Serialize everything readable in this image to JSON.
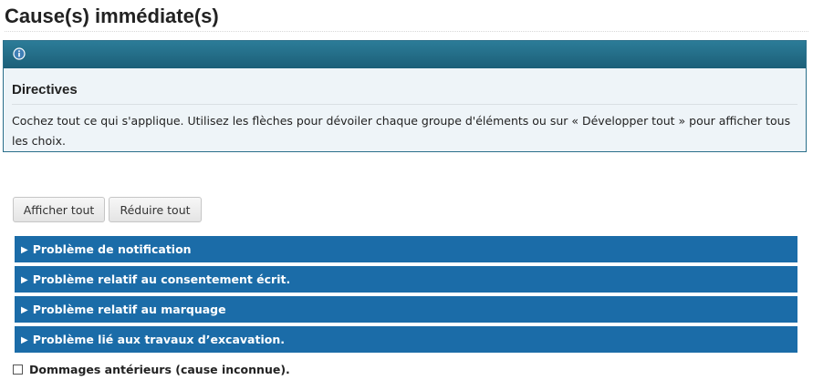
{
  "page": {
    "title": "Cause(s) immédiate(s)"
  },
  "info_panel": {
    "icon": "info-icon",
    "heading": "Directives",
    "text": "Cochez tout ce qui s'applique. Utilisez les flèches pour dévoiler chaque groupe d'éléments ou sur « Développer tout » pour afficher tous les choix."
  },
  "toolbar": {
    "show_all_label": "Afficher tout",
    "collapse_all_label": "Réduire tout"
  },
  "groups": [
    {
      "label": "Problème de notification",
      "expanded": false
    },
    {
      "label": "Problème relatif au consentement écrit.",
      "expanded": false
    },
    {
      "label": "Problème relatif au marquage",
      "expanded": false
    },
    {
      "label": "Problème lié aux travaux d’excavation.",
      "expanded": false
    }
  ],
  "checkbox_item": {
    "label": "Dommages antérieurs (cause inconnue).",
    "checked": false
  },
  "colors": {
    "header_bar": "#1c5f78",
    "group_bar": "#1b6ca8",
    "panel_bg": "#eef4f8"
  }
}
